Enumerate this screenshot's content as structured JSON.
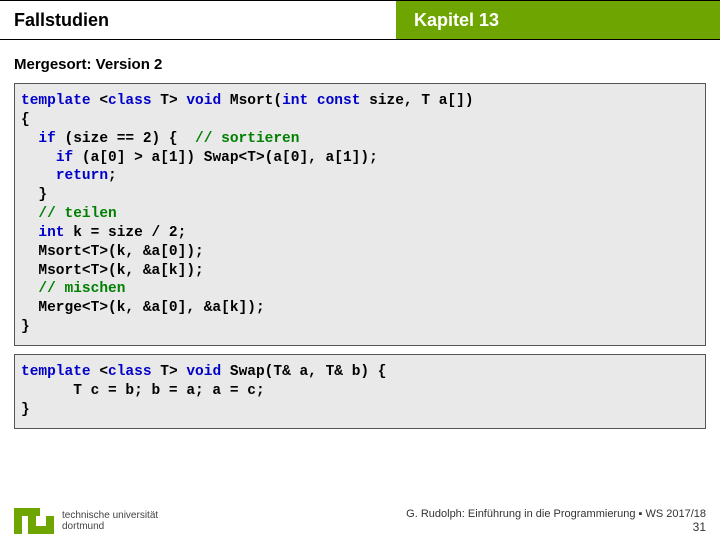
{
  "header": {
    "left": "Fallstudien",
    "right": "Kapitel 13"
  },
  "section": {
    "title": "Mergesort: Version 2"
  },
  "code1": {
    "l1a": "template",
    "l1b": " <",
    "l1c": "class",
    "l1d": " T> ",
    "l1e": "void",
    "l1f": " Msort(",
    "l1g": "int",
    "l1h": " ",
    "l1i": "const",
    "l1j": " size, T a[])",
    "l2": "{",
    "l3a": "  ",
    "l3b": "if",
    "l3c": " (size == 2) {  ",
    "l3d": "// sortieren",
    "l4a": "    ",
    "l4b": "if",
    "l4c": " (a[0] > a[1]) Swap<T>(a[0], a[1]);",
    "l5a": "    ",
    "l5b": "return",
    "l5c": ";",
    "l6": "  }",
    "l7a": "  ",
    "l7b": "// teilen",
    "l8a": "  ",
    "l8b": "int",
    "l8c": " k = size / 2;",
    "l9": "  Msort<T>(k, &a[0]);",
    "l10": "  Msort<T>(k, &a[k]);",
    "l11a": "  ",
    "l11b": "// mischen",
    "l12": "  Merge<T>(k, &a[0], &a[k]);",
    "l13": "}"
  },
  "code2": {
    "l1a": "template",
    "l1b": " <",
    "l1c": "class",
    "l1d": " T> ",
    "l1e": "void",
    "l1f": " Swap(T& a, T& b) {",
    "l2": "      T c = b; b = a; a = c;",
    "l3": "}"
  },
  "footer": {
    "uni1": "technische universität",
    "uni2": "dortmund",
    "credit": "G. Rudolph: Einführung in die Programmierung ▪ WS 2017/18",
    "page": "31"
  }
}
